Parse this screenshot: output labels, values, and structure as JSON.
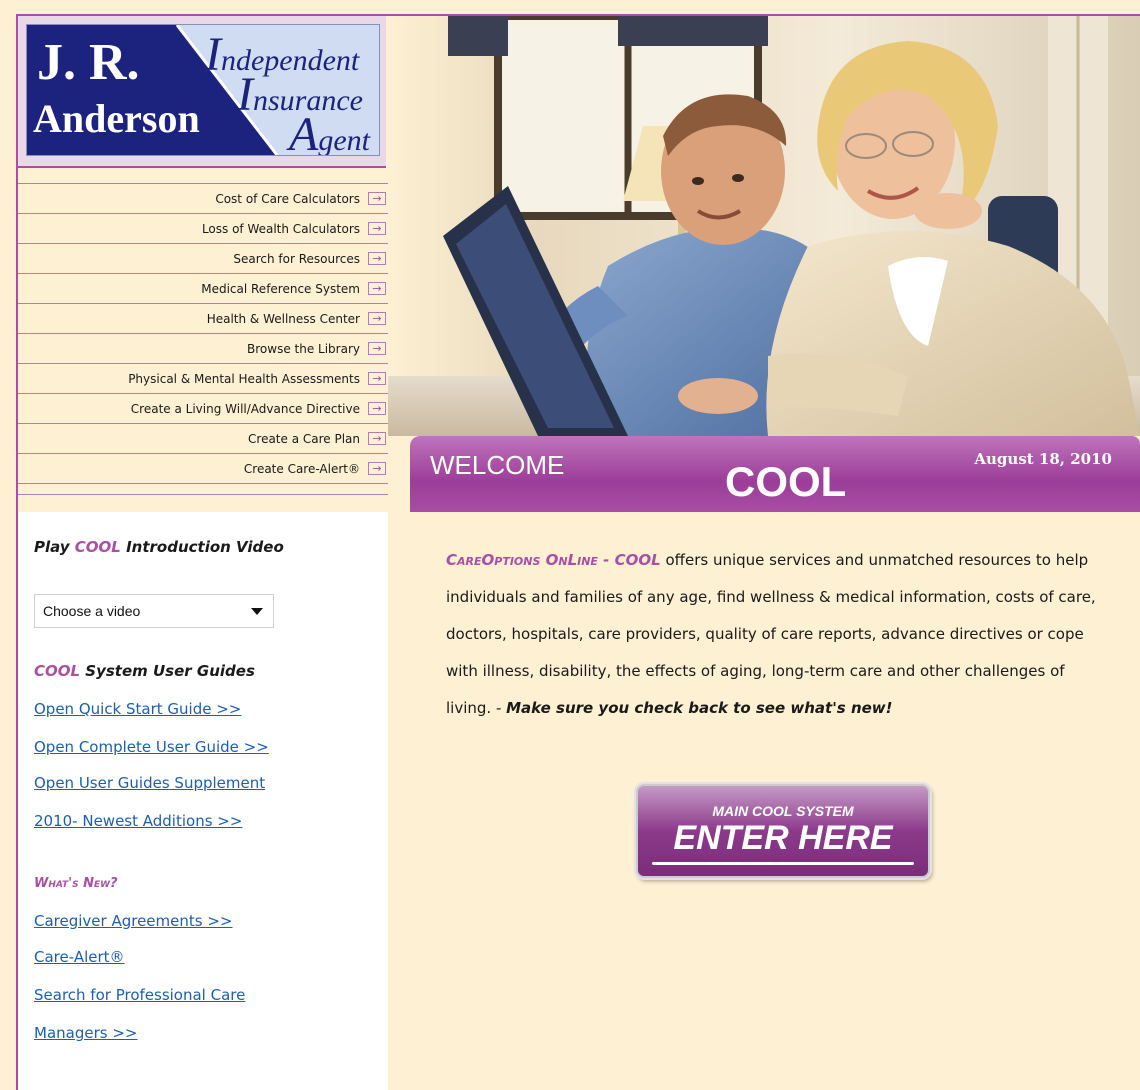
{
  "logo": {
    "name_line1": "J. R.",
    "name_line2": "Anderson",
    "agent_line1_cap": "I",
    "agent_line1_rest": "ndependent",
    "agent_line2_cap": "I",
    "agent_line2_rest": "nsurance",
    "agent_line3_cap": "A",
    "agent_line3_rest": "gent"
  },
  "nav": {
    "items": [
      {
        "label": "Cost of Care Calculators"
      },
      {
        "label": "Loss of Wealth Calculators"
      },
      {
        "label": "Search for Resources"
      },
      {
        "label": "Medical Reference System"
      },
      {
        "label": "Health & Wellness Center"
      },
      {
        "label": "Browse the Library"
      },
      {
        "label": "Physical & Mental Health Assessments"
      },
      {
        "label": "Create a Living Will/Advance Directive"
      },
      {
        "label": "Create a Care Plan"
      },
      {
        "label": "Create Care-Alert®"
      }
    ]
  },
  "banner": {
    "welcome": "WELCOME",
    "title": "COOL",
    "date": "August 18, 2010"
  },
  "sidebar": {
    "video_title_pre": "Play ",
    "video_title_brand": "COOL",
    "video_title_post": " Introduction Video",
    "video_select_value": "Choose a video",
    "guides_title_brand": "COOL",
    "guides_title_post": " System User Guides",
    "guide_links": [
      "Open Quick Start Guide >>",
      "Open Complete User Guide >>",
      "Open User Guides Supplement",
      "2010- Newest Additions >>"
    ],
    "whats_new_title": "What's New?",
    "whats_new_links": [
      "Caregiver Agreements >>",
      "Care-Alert®",
      "Search for Professional Care",
      "Managers >>"
    ]
  },
  "main": {
    "brand": "CareOptions OnLine - COOL",
    "intro": " offers unique services and unmatched resources to help individuals and families of any age, find wellness & medical information, costs of care, doctors, hospitals, care providers, quality of care reports, advance directives or cope with illness, disability, the effects of aging, long-term care and other challenges of living. - ",
    "emphasis": "Make sure you check back to see what's new!",
    "enter_button": {
      "line1": "MAIN COOL SYSTEM",
      "line2": "ENTER HERE"
    }
  },
  "colors": {
    "accent": "#a94fa4",
    "background": "#fdf0d3",
    "logo_navy": "#1c237e",
    "link": "#1a5fb4"
  }
}
